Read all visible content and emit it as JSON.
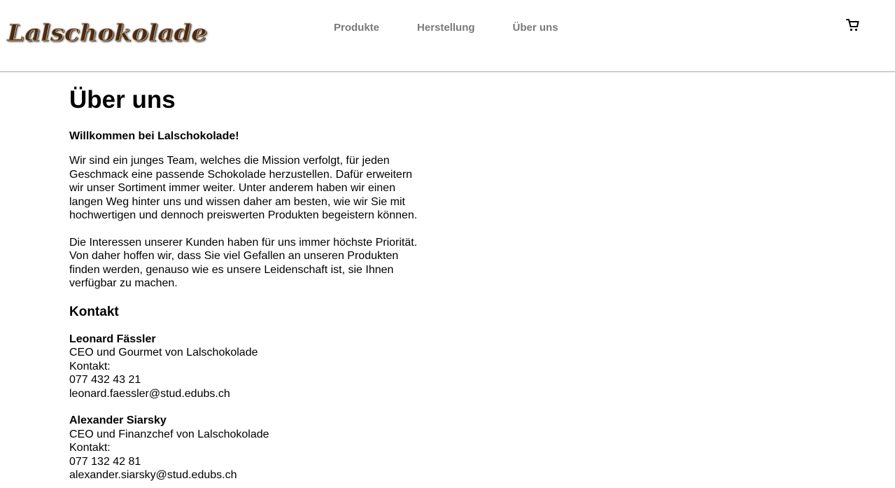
{
  "brand": {
    "logo_text": "Lalschokolade"
  },
  "nav": {
    "items": [
      {
        "label": "Produkte"
      },
      {
        "label": "Herstellung"
      },
      {
        "label": "Über uns"
      }
    ]
  },
  "cart": {
    "icon": "shopping-cart-icon"
  },
  "main": {
    "title": "Über uns",
    "welcome": "Willkommen bei Lalschokolade!",
    "paragraphs": [
      "Wir sind ein junges Team, welches die Mission verfolgt, für jeden Geschmack eine passende Schokolade herzustellen. Dafür erweitern wir unser Sortiment immer weiter. Unter anderem haben wir einen langen Weg hinter uns und wissen daher am besten, wie wir Sie mit hochwertigen und dennoch preiswerten Produkten begeistern können.",
      "Die Interessen unserer Kunden haben für uns immer höchste Priorität. Von daher hoffen wir, dass Sie viel Gefallen an unseren Produkten finden werden, genauso wie es unsere Leidenschaft ist, sie Ihnen verfügbar zu machen."
    ],
    "contact_heading": "Kontakt",
    "contacts": [
      {
        "name": "Leonard Fässler",
        "role": "CEO und Gourmet von Lalschokolade",
        "contact_label": "Kontakt:",
        "phone": "077 432 43 21",
        "email": "leonard.faessler@stud.edubs.ch"
      },
      {
        "name": "Alexander Siarsky",
        "role": "CEO und Finanzchef von Lalschokolade",
        "contact_label": "Kontakt:",
        "phone": "077 132 42 81",
        "email": "alexander.siarsky@stud.edubs.ch"
      }
    ]
  }
}
